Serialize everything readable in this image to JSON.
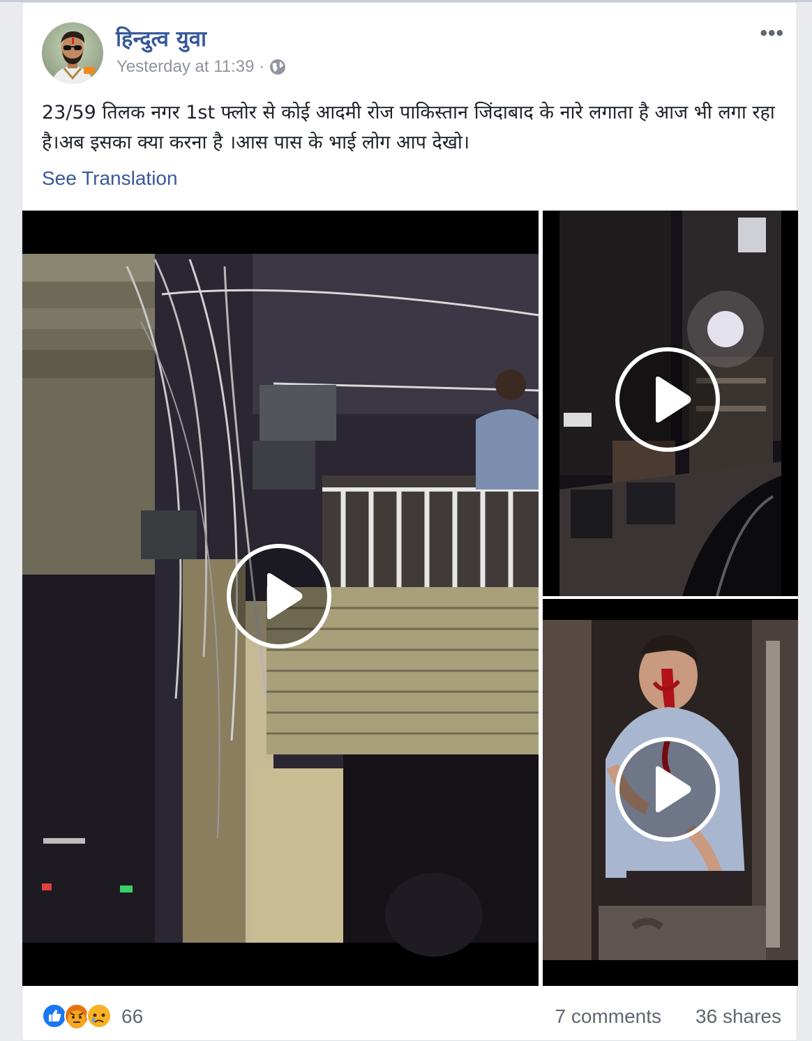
{
  "post": {
    "author": "हिन्दुत्व युवा",
    "time": "Yesterday at 11:39 ·",
    "body": "23/59 तिलक नगर 1st फ्लोर से कोई आदमी रोज पाकिस्तान जिंदाबाद के नारे लगाता है आज भी लगा रहा है।अब इसका क्या करना है  ।आस पास के भाई लोग आप देखो।",
    "see_translation": "See Translation",
    "more_label": "•••"
  },
  "media": {
    "videos": [
      {
        "name": "night balcony with electric wires",
        "icon": "play-icon"
      },
      {
        "name": "night street with lamp",
        "icon": "play-icon"
      },
      {
        "name": "injured man in doorway",
        "icon": "play-icon"
      }
    ]
  },
  "footer": {
    "reactions": [
      "like-icon",
      "angry-icon",
      "sad-icon"
    ],
    "reaction_count": "66",
    "comments": "7 comments",
    "shares": "36 shares"
  },
  "colors": {
    "link": "#385898",
    "name": "#365899",
    "muted": "#90949c",
    "like": "#1877f2",
    "angry": "#e9710f",
    "sad": "#f7b125"
  }
}
